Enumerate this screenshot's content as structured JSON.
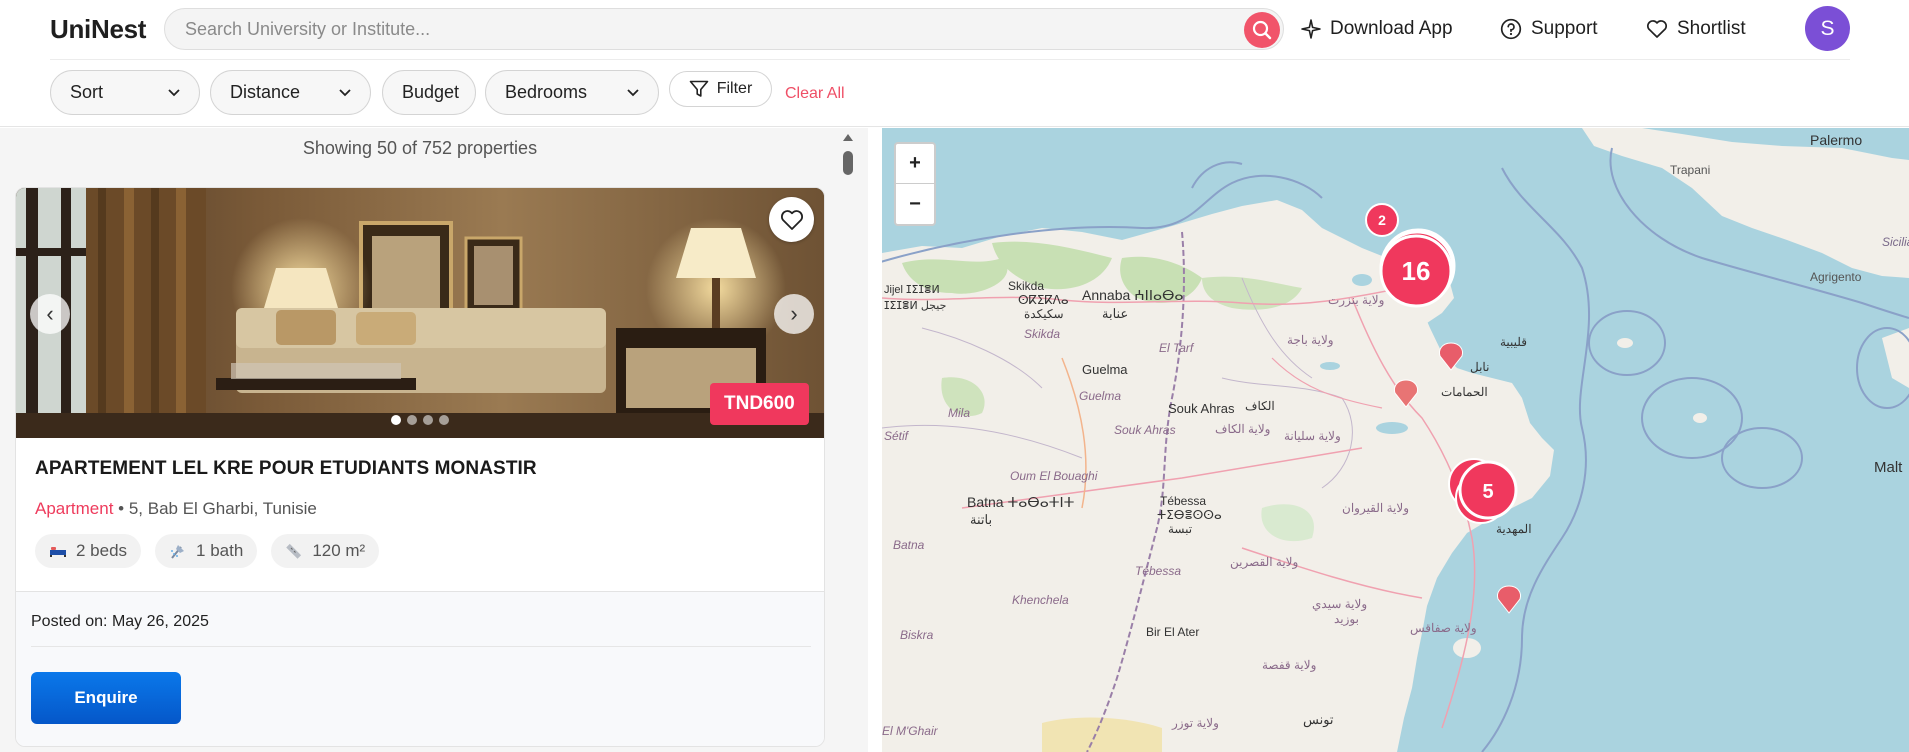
{
  "header": {
    "logo": "UniNest",
    "search_placeholder": "Search University or Institute...",
    "nav": {
      "download_app": "Download App",
      "support": "Support",
      "shortlist": "Shortlist"
    },
    "avatar_initial": "S",
    "accent_color": "#f1546a",
    "avatar_color": "#7b4fd6"
  },
  "filters": {
    "sort": "Sort",
    "distance": "Distance",
    "budget": "Budget",
    "bedrooms": "Bedrooms",
    "filter": "Filter",
    "clear_all": "Clear All"
  },
  "listing": {
    "count_text": "Showing 50 of 752 properties",
    "card": {
      "price": "TND600",
      "title": "APARTEMENT LEL KRE POUR ETUDIANTS MONASTIR",
      "type": "Apartment",
      "address": " • 5, Bab El Gharbi, Tunisie",
      "beds": "2 beds",
      "baths": "1 bath",
      "area": "120 m²",
      "posted": "Posted on: May 26, 2025",
      "enquire": "Enquire",
      "image_count": 4,
      "active_image": 1
    }
  },
  "map": {
    "zoom_in": "+",
    "zoom_out": "−",
    "clusters": [
      {
        "count": "16",
        "color": "#f0385d"
      },
      {
        "count": "5",
        "color": "#f0385d"
      },
      {
        "count": "2",
        "color": "#f0385d"
      }
    ],
    "labels": {
      "palermo": "Palermo",
      "trapani": "Trapani",
      "sicilia": "Sicilia",
      "agrigento": "Agrigento",
      "malta": "Malt",
      "skikda": "Skikda",
      "skikda_tif": "ⵙⴽⵉⴽⴷⴰ",
      "skikda_ar": "سكيكدة",
      "skikda2": "Skikda",
      "annaba": "Annaba ⵄⵏⵏⴰⴱⴰ",
      "annaba_ar": "عنابة",
      "jijel": "Jijel ⵊⵉⵊⴻⵍ",
      "jijel_ar": "ⵊⵉⵊⴻⵍ جيجل",
      "el_tarf": "El Tarf",
      "guelma": "Guelma",
      "guelma2": "Guelma",
      "mila": "Mila",
      "setif": "Sétif",
      "souk_ahras": "Souk Ahras",
      "souk_ahras2": "Souk Ahras",
      "oum_el_bouaghi": "Oum El Bouaghi",
      "batna": "Batna ⵜⴰⴱⴰⵜⵏⵜ",
      "batna_ar": "باتنة",
      "batna2": "Batna",
      "tebessa": "Tébessa",
      "tebessa_tif": "ⵜⵉⴱⴻⵙⵙⴰ",
      "tebessa_ar": "تبسة",
      "tebessa2": "Tébessa",
      "khenchela": "Khenchela",
      "biskra": "Biskra",
      "bir_el_ater": "Bir El Ater",
      "m_ghair": "El M'Ghair",
      "bizerte": "ولاية بنزرت",
      "beja": "ولاية باجة",
      "nabeul": "نابل",
      "hammamet": "الحمامات",
      "kelibia": "قليبية",
      "kef": "الكاف",
      "kef2": "ولاية الكاف",
      "siliana": "ولاية سليانة",
      "kairouan": "ولاية القيروان",
      "kasserine": "ولاية القصرين",
      "sidi_bouzid": "ولاية سيدي بوزيد",
      "sfax": "ولاية صفاقس",
      "gafsa": "ولاية قفصة",
      "tozeur": "ولاية توزر",
      "tunis_bottom": "تونس",
      "mahdia": "المهدية"
    }
  }
}
